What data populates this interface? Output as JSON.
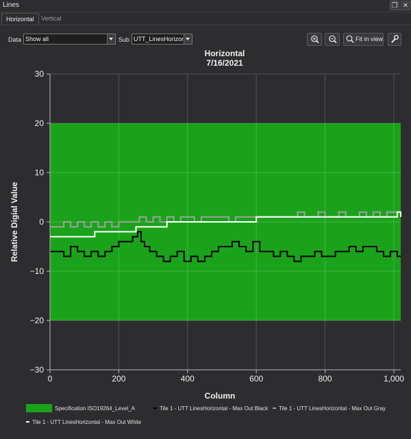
{
  "window": {
    "title": "Lines"
  },
  "tabs": [
    {
      "label": "Horizontal",
      "active": true
    },
    {
      "label": "Vertical",
      "active": false
    }
  ],
  "toolbar": {
    "data_label": "Data",
    "data_value": "Show all",
    "sub_label": "Sub",
    "sub_value": "UTT_LinesHorizontal",
    "zoom_in_icon": "zoom-in-icon",
    "zoom_out_icon": "zoom-out-icon",
    "fit_label": "Fit in view",
    "settings_icon": "wrench-icon"
  },
  "colors": {
    "spec": "#1aa31a",
    "black": "#000000",
    "gray": "#a0a0a0",
    "white": "#ffffff",
    "background": "#2d2d30"
  },
  "chart_data": {
    "type": "line",
    "title": "Horizontal",
    "subtitle": "7/16/2021",
    "xlabel": "Column",
    "ylabel": "Relative Digial Value",
    "xlim": [
      0,
      1020
    ],
    "ylim": [
      -30,
      30
    ],
    "xticks": [
      0,
      200,
      400,
      600,
      800,
      1000
    ],
    "xtick_labels": [
      "0",
      "200",
      "400",
      "600",
      "800",
      "1,000"
    ],
    "yticks": [
      -30,
      -20,
      -10,
      0,
      10,
      20,
      30
    ],
    "ytick_labels": [
      "−30",
      "−20",
      "−10",
      "0",
      "10",
      "20",
      "30"
    ],
    "grid": true,
    "legend_position": "bottom",
    "band": {
      "name": "Specification ISO19264_Level_A",
      "y_from": -20,
      "y_to": 20,
      "color": "#1aa31a"
    },
    "series": [
      {
        "name": "Tile 1 - UTT LinesHorizontal - Max Out Black",
        "color": "#000000",
        "x": [
          0,
          20,
          40,
          60,
          80,
          100,
          120,
          140,
          160,
          180,
          200,
          220,
          240,
          255,
          265,
          275,
          290,
          310,
          330,
          350,
          370,
          390,
          410,
          430,
          450,
          470,
          490,
          510,
          530,
          550,
          570,
          590,
          610,
          630,
          650,
          670,
          690,
          710,
          730,
          750,
          770,
          790,
          810,
          830,
          850,
          870,
          890,
          910,
          930,
          950,
          970,
          990,
          1010,
          1020
        ],
        "y": [
          -6,
          -6,
          -7,
          -5,
          -6,
          -7,
          -6,
          -7,
          -6,
          -5,
          -4,
          -4,
          -3,
          -2,
          -4,
          -5,
          -6,
          -7,
          -8,
          -7,
          -6,
          -8,
          -7,
          -8,
          -7,
          -6,
          -5,
          -5,
          -4,
          -5,
          -6,
          -4,
          -6,
          -6,
          -7,
          -6,
          -7,
          -8,
          -7,
          -7,
          -6,
          -7,
          -7,
          -6,
          -6,
          -5,
          -6,
          -5,
          -5,
          -6,
          -7,
          -6,
          -7,
          -7
        ]
      },
      {
        "name": "Tile 1 - UTT LinesHorizontal - Max Out Gray",
        "color": "#a0a0a0",
        "x": [
          0,
          20,
          40,
          60,
          80,
          100,
          120,
          140,
          160,
          180,
          200,
          220,
          240,
          260,
          280,
          300,
          320,
          340,
          360,
          380,
          400,
          420,
          440,
          460,
          480,
          500,
          520,
          540,
          560,
          580,
          600,
          620,
          640,
          660,
          680,
          700,
          720,
          740,
          760,
          780,
          800,
          820,
          840,
          860,
          880,
          900,
          920,
          940,
          960,
          980,
          1000,
          1020
        ],
        "y": [
          -1,
          -1,
          0,
          -1,
          0,
          -1,
          0,
          -1,
          0,
          -1,
          0,
          0,
          0,
          1,
          0,
          1,
          0,
          1,
          0,
          1,
          1,
          0,
          1,
          1,
          1,
          1,
          0,
          1,
          1,
          1,
          1,
          1,
          1,
          1,
          1,
          1,
          2,
          1,
          1,
          2,
          1,
          1,
          2,
          1,
          1,
          2,
          1,
          2,
          1,
          2,
          2,
          2
        ]
      },
      {
        "name": "Tile 1 - UTT LinesHorizontal - Max Out White",
        "color": "#ffffff",
        "x": [
          0,
          60,
          80,
          100,
          130,
          140,
          160,
          170,
          200,
          240,
          250,
          260,
          300,
          310,
          320,
          340,
          360,
          380,
          400,
          420,
          440,
          460,
          480,
          500,
          520,
          540,
          560,
          580,
          600,
          640,
          700,
          760,
          820,
          880,
          940,
          1000,
          1010,
          1020
        ],
        "y": [
          -3,
          -3,
          -3,
          -3,
          -2,
          -2,
          -2,
          -2,
          -2,
          -2,
          -1,
          -1,
          -1,
          -1,
          -1,
          0,
          0,
          0,
          0,
          0,
          0,
          0,
          0,
          0,
          0,
          0,
          0,
          0,
          1,
          1,
          1,
          1,
          1,
          1,
          1,
          1,
          2,
          1
        ]
      }
    ]
  }
}
